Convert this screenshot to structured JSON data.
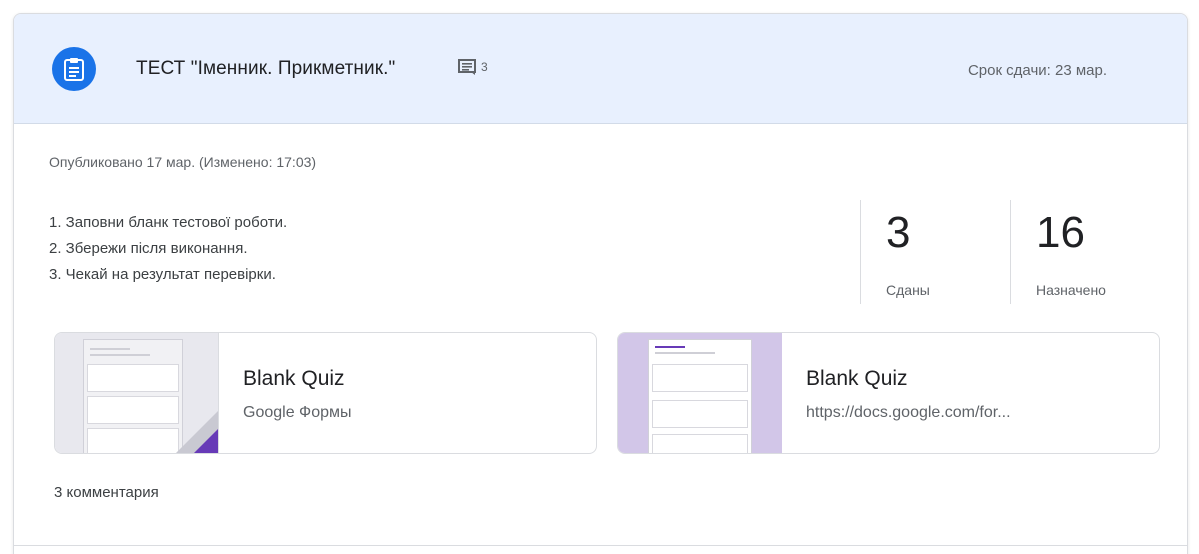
{
  "assignment": {
    "title": "ТЕСТ \"Іменник. Прикметник.\"",
    "comment_count": "3",
    "due": "Срок сдачи: 23 мар.",
    "published": "Опубликовано 17 мар. (Изменено: 17:03)",
    "instructions": [
      "1. Заповни бланк тестової роботи.",
      "2. Збережи після виконання.",
      "3. Чекай на результат перевірки."
    ],
    "icon": "assignment-icon",
    "accent_color": "#1a73e8",
    "header_bg": "#e8f0fe"
  },
  "stats": {
    "turned_in": {
      "value": "3",
      "label": "Сданы"
    },
    "assigned": {
      "value": "16",
      "label": "Назначено"
    }
  },
  "attachments": [
    {
      "title": "Blank Quiz",
      "subtitle": "Google Формы"
    },
    {
      "title": "Blank Quiz",
      "subtitle": "https://docs.google.com/for..."
    }
  ],
  "comments": {
    "label": "3 комментария"
  }
}
